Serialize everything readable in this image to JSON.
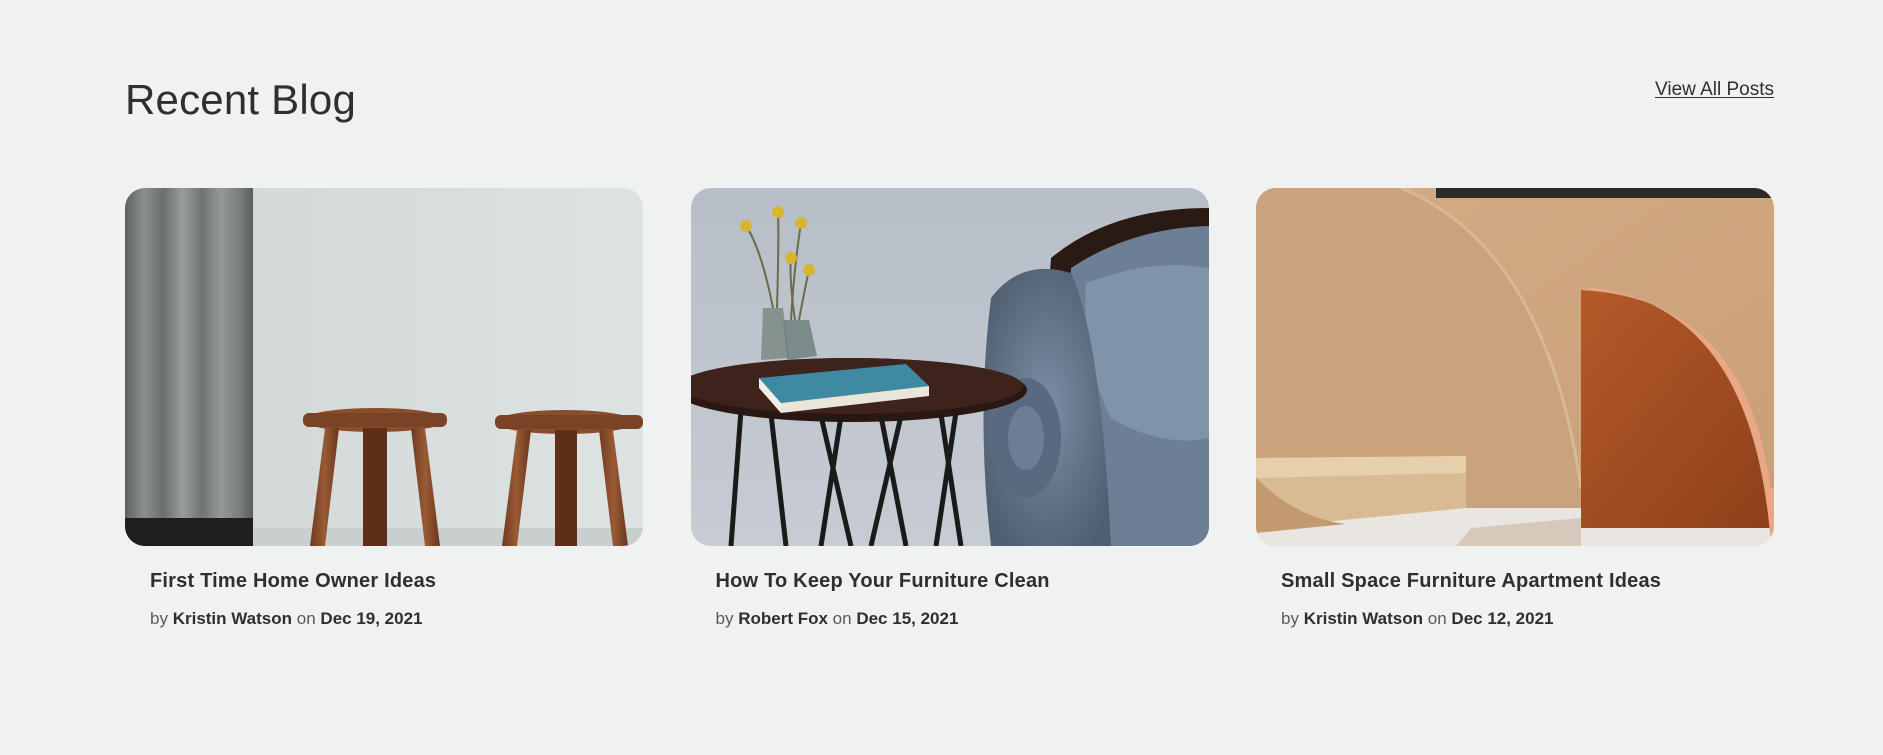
{
  "header": {
    "title": "Recent Blog",
    "view_all_label": "View All Posts"
  },
  "posts": [
    {
      "title": "First Time Home Owner Ideas",
      "by_label": "by",
      "author": "Kristin Watson",
      "on_label": "on",
      "date": "Dec 19, 2021",
      "image": "stools-curtain-photo"
    },
    {
      "title": "How To Keep Your Furniture Clean",
      "by_label": "by",
      "author": "Robert Fox",
      "on_label": "on",
      "date": "Dec 15, 2021",
      "image": "side-table-sofa-photo"
    },
    {
      "title": "Small Space Furniture Apartment Ideas",
      "by_label": "by",
      "author": "Kristin Watson",
      "on_label": "on",
      "date": "Dec 12, 2021",
      "image": "wooden-shapes-photo"
    }
  ],
  "colors": {
    "background": "#eff2f1",
    "text": "#2f2f2f"
  }
}
